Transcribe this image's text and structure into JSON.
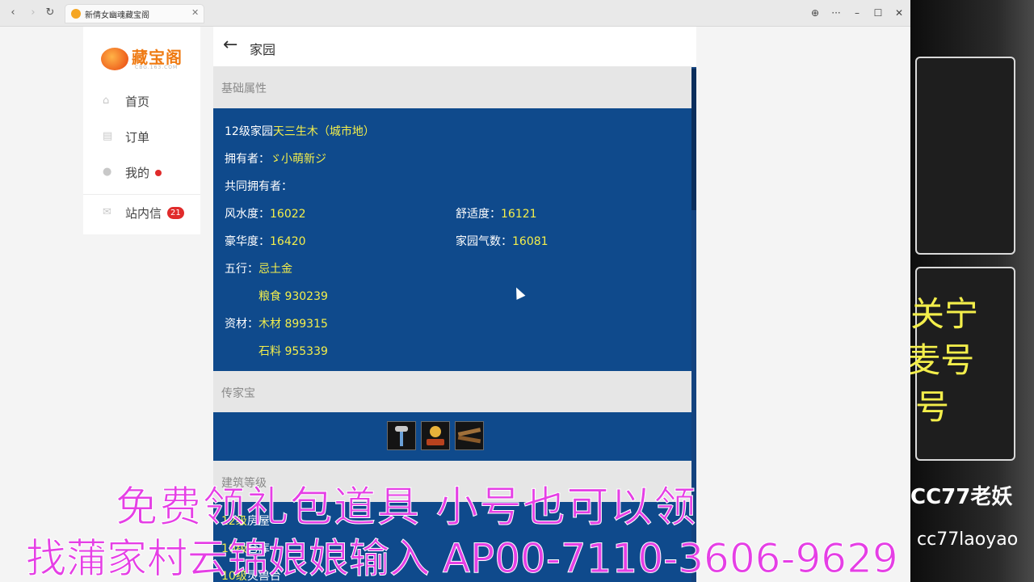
{
  "browser": {
    "tab_title": "新倩女幽魂藏宝阁",
    "back": "‹",
    "forward": "›",
    "reload": "↻",
    "tab_close": "✕",
    "controls": {
      "globe": "⊕",
      "more": "···",
      "minimize": "–",
      "maximize": "☐",
      "close": "✕"
    }
  },
  "sidebar": {
    "logo_text": "藏宝阁",
    "logo_sub": "CBG.163.COM",
    "items": [
      {
        "label": "首页",
        "icon": "home-icon"
      },
      {
        "label": "订单",
        "icon": "order-icon"
      },
      {
        "label": "我的",
        "icon": "user-icon"
      },
      {
        "label": "站内信",
        "icon": "mail-icon",
        "badge": "21"
      }
    ]
  },
  "header": {
    "back": "←",
    "title": "家园"
  },
  "basic": {
    "section_title": "基础属性",
    "home_prefix": "12级家园",
    "home_name": "天三生木（城市地）",
    "owner_label": "拥有者：",
    "owner_value": "ゞ小萌新ジ",
    "coowner_label": "共同拥有者：",
    "fengshui_label": "风水度：",
    "fengshui_value": "16022",
    "comfort_label": "舒适度：",
    "comfort_value": "16121",
    "luxury_label": "豪华度：",
    "luxury_value": "16420",
    "qi_label": "家园气数：",
    "qi_value": "16081",
    "wuxing_label": "五行：",
    "wuxing_value": "忌土金",
    "grain": "粮食 930239",
    "resource_label": "资材：",
    "wood": "木材 899315",
    "stone": "石料 955339"
  },
  "heirloom": {
    "section_title": "传家宝",
    "items": [
      "lamp-item-icon",
      "orb-item-icon",
      "wood-item-icon"
    ]
  },
  "buildings": {
    "section_title": "建筑等级",
    "items": [
      {
        "level": "12级",
        "name": "房屋"
      },
      {
        "level": "10级",
        "name": "仓库"
      },
      {
        "level": "10级",
        "name": "灵兽台"
      }
    ]
  },
  "stream": {
    "text1": "关宁",
    "text2": "r麦号",
    "text3": "号",
    "streamer_name": "CC77老妖",
    "streamer_id": "cc77laoyao"
  },
  "promo": {
    "line1": "免费领礼包道具 小号也可以领",
    "line2": "找蒲家村云锦娘娘输入 AP00-7110-3606-9629"
  },
  "colors": {
    "panel_blue": "#0f4a8c",
    "highlight_yellow": "#f3ee4b",
    "badge_red": "#e02b2b",
    "promo_magenta": "#e53fe5"
  }
}
